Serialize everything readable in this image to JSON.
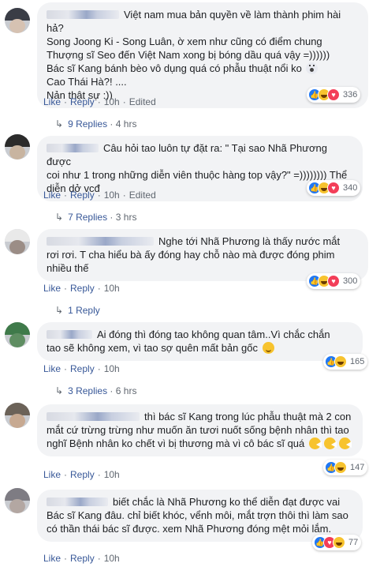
{
  "comments": [
    {
      "lines": [
        "Việt nam mua bản quyền về làm thành phim hài hả?",
        "Song Joong Ki - Song Luân, ờ xem như cũng có điểm chung",
        "Thượng sĩ Seo đến Việt Nam xong bị bóng dầu quá vậy =))))))",
        "Bác sĩ Kang bánh bèo vô dụng quá có phẫu thuật nổi ko",
        "Cao Thái Hà?! ....",
        "Nản thật sự :))"
      ],
      "emoji": "shock",
      "like": "Like",
      "reply": "Reply",
      "time": "10h",
      "edited": "Edited",
      "reaction_count": "336",
      "replies_label": "9 Replies",
      "replies_time": "4 hrs"
    },
    {
      "lines": [
        "Câu hỏi tao luôn tự đặt ra: \" Tại sao Nhã Phương được",
        "coi như 1 trong những diễn viên thuộc hàng top vậy?\" =)))))))) Thể",
        "diễn dở vcđ"
      ],
      "like": "Like",
      "reply": "Reply",
      "time": "10h",
      "edited": "Edited",
      "reaction_count": "340",
      "replies_label": "7 Replies",
      "replies_time": "3 hrs"
    },
    {
      "lines": [
        "Nghe tới Nhã Phương là thấy nước mắt",
        "rơi rơi. T cha hiểu bà ấy đóng hay chỗ nào mà được đóng phim",
        "nhiều thế"
      ],
      "like": "Like",
      "reply": "Reply",
      "time": "10h",
      "reaction_count": "300",
      "replies_label": "1 Reply",
      "replies_time": ""
    },
    {
      "lines": [
        "Ai đóng thì đóng tao không quan tâm..Vì chắc chắn",
        "tao sẽ không xem, vì tao sợ quên mất bản gốc"
      ],
      "emoji": "smile",
      "like": "Like",
      "reply": "Reply",
      "time": "10h",
      "reaction_count": "165",
      "replies_label": "3 Replies",
      "replies_time": "6 hrs"
    },
    {
      "lines": [
        "thì bác sĩ Kang trong lúc phẫu thuật mà 2 con",
        "mắt cứ trừng trừng như muốn ăn tươi nuốt sống bệnh nhân thì tao",
        "nghĩ Bệnh nhân ko chết vì bị thương mà vì cô bác sĩ quá"
      ],
      "emoji": "pac",
      "like": "Like",
      "reply": "Reply",
      "time": "10h",
      "reaction_count": "147"
    },
    {
      "lines": [
        "biết chắc là Nhã Phương ko thể diễn đạt được vai",
        "Bác sĩ Kang đâu. chỉ biết khóc, vểnh môi, mắt trợn thôi thì làm sao",
        "có thần thái bác sĩ được. xem Nhã Phương đóng mệt mỏi lắm."
      ],
      "like": "Like",
      "reply": "Reply",
      "time": "10h",
      "reaction_count": "77"
    }
  ],
  "colors": {
    "link": "#385898",
    "meta": "#606770",
    "bubble": "#f2f3f5",
    "like": "#2078f4",
    "haha": "#f7c32e",
    "love": "#f33e58"
  }
}
